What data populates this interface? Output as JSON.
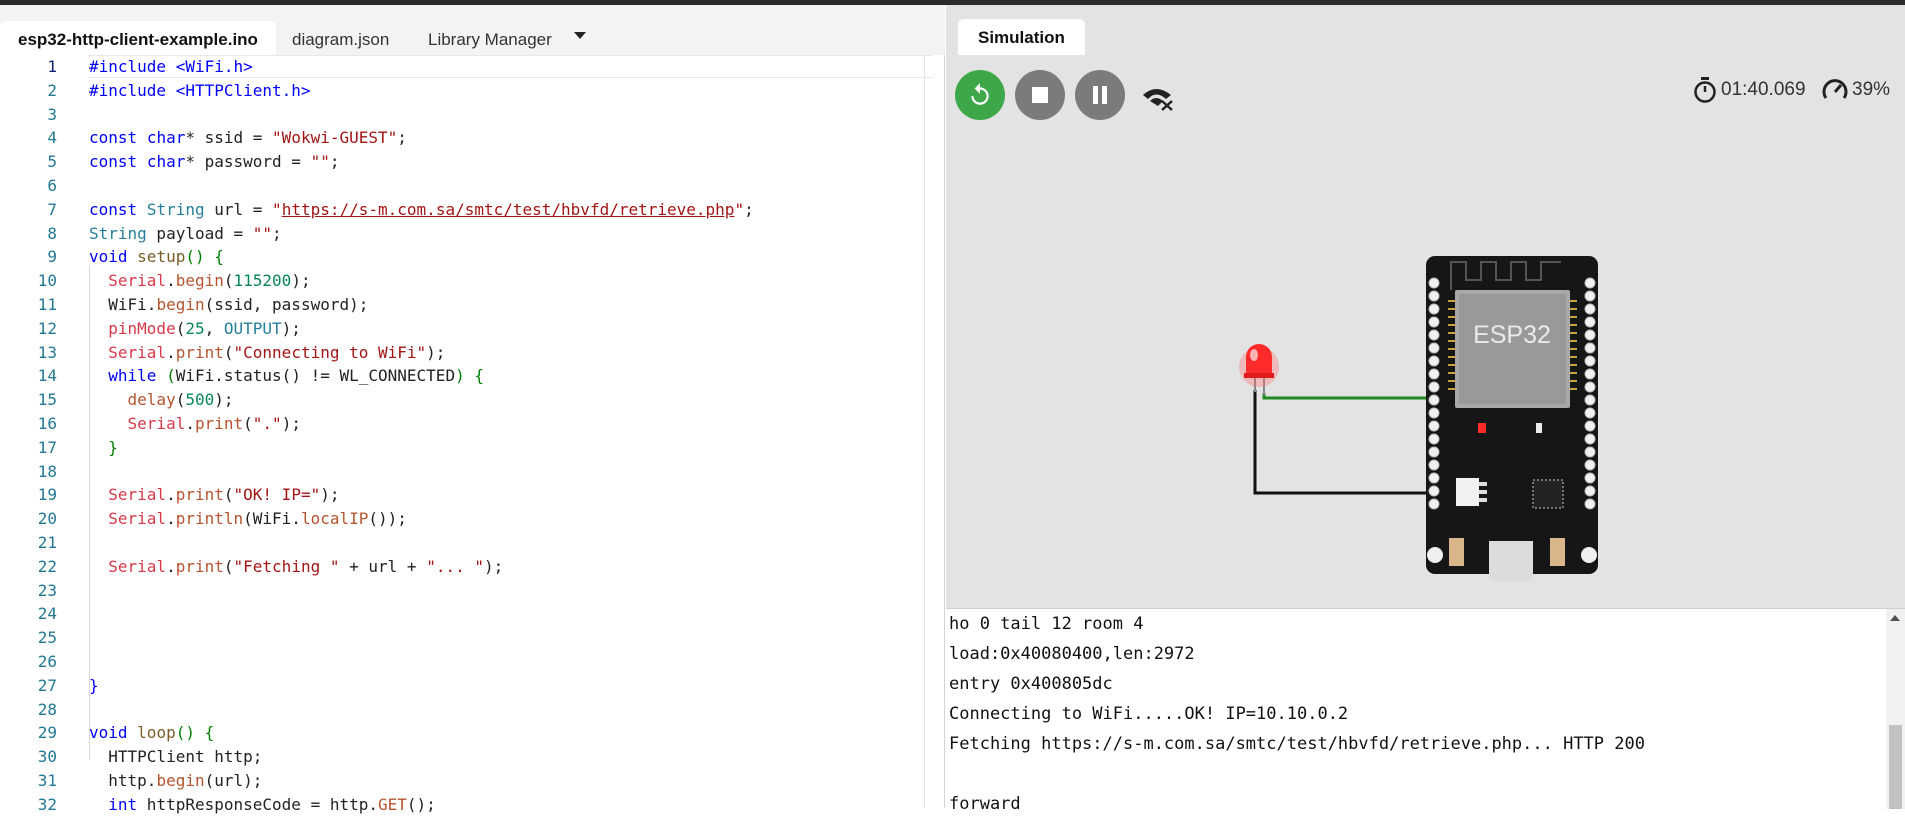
{
  "editor": {
    "tabs": [
      {
        "label": "esp32-http-client-example.ino"
      },
      {
        "label": "diagram.json"
      },
      {
        "label": "Library Manager"
      }
    ],
    "lines": [
      {
        "num": "1"
      },
      {
        "num": "2"
      },
      {
        "num": "3"
      },
      {
        "num": "4"
      },
      {
        "num": "5"
      },
      {
        "num": "6"
      },
      {
        "num": "7"
      },
      {
        "num": "8"
      },
      {
        "num": "9"
      },
      {
        "num": "10"
      },
      {
        "num": "11"
      },
      {
        "num": "12"
      },
      {
        "num": "13"
      },
      {
        "num": "14"
      },
      {
        "num": "15"
      },
      {
        "num": "16"
      },
      {
        "num": "17"
      },
      {
        "num": "18"
      },
      {
        "num": "19"
      },
      {
        "num": "20"
      },
      {
        "num": "21"
      },
      {
        "num": "22"
      },
      {
        "num": "23"
      },
      {
        "num": "24"
      },
      {
        "num": "25"
      },
      {
        "num": "26"
      },
      {
        "num": "27"
      },
      {
        "num": "28"
      },
      {
        "num": "29"
      },
      {
        "num": "30"
      },
      {
        "num": "31"
      },
      {
        "num": "32"
      }
    ],
    "code": {
      "l1": "#include <WiFi.h>",
      "l2": "#include <HTTPClient.h>",
      "ssid_value": "\"Wokwi-GUEST\"",
      "password_value": "\"\"",
      "url_value": "https://s-m.com.sa/smtc/test/hbvfd/retrieve.php",
      "baud": "115200",
      "pin": "25",
      "pin_mode": "OUTPUT",
      "connecting_msg": "\"Connecting to WiFi\"",
      "delay_ms": "500",
      "dot_msg": "\".\"",
      "ok_msg": "\"OK! IP=\"",
      "fetching_msg": "\"Fetching \"",
      "ellipsis_msg": "\"... \""
    }
  },
  "simulation": {
    "tab_label": "Simulation",
    "timer": "01:40.069",
    "speed": "39%",
    "chip_label": "ESP32",
    "colors": {
      "restart": "#3ea74a",
      "control": "#7b7b7b",
      "led": "#ff2a2a",
      "wire_green": "#1f8a1f"
    },
    "icons": [
      "restart-icon",
      "stop-icon",
      "pause-icon",
      "wifi-off-icon",
      "stopwatch-icon",
      "speedometer-icon"
    ]
  },
  "serial": {
    "lines": [
      "ho 0 tail 12 room 4",
      "load:0x40080400,len:2972",
      "entry 0x400805dc",
      "Connecting to WiFi.....OK! IP=10.10.0.2",
      "Fetching https://s-m.com.sa/smtc/test/hbvfd/retrieve.php... HTTP 200",
      "",
      "forward"
    ]
  }
}
